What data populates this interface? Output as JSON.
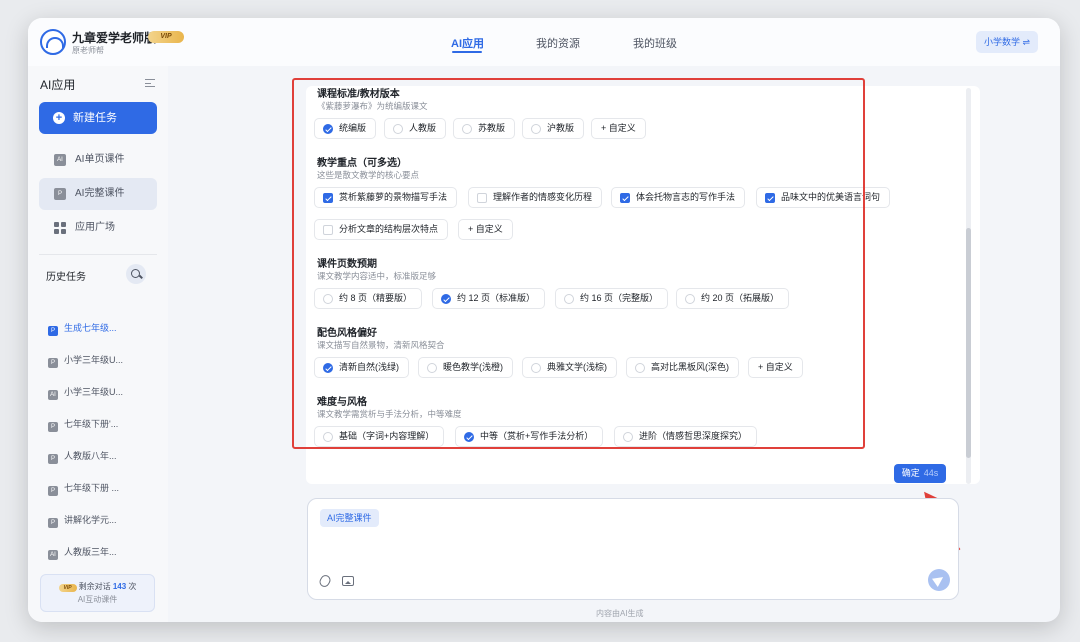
{
  "app": {
    "title": "九章爱学老师版",
    "subtitle": "原老师帮",
    "vip_badge": "VIP"
  },
  "nav": {
    "tabs": [
      {
        "label": "AI应用",
        "active": true
      },
      {
        "label": "我的资源",
        "active": false
      },
      {
        "label": "我的班级",
        "active": false
      }
    ],
    "subject": "小学数学 ⇌"
  },
  "sidebar": {
    "title": "AI应用",
    "new_task": "新建任务",
    "items": [
      {
        "label": "AI单页课件",
        "icon": "ai-page-icon"
      },
      {
        "label": "AI完整课件",
        "icon": "ai-full-icon",
        "active": true
      },
      {
        "label": "应用广场",
        "icon": "grid-icon"
      }
    ],
    "history_title": "历史任务",
    "history": [
      {
        "label": "生成七年级...",
        "icon": "P",
        "active": true
      },
      {
        "label": "小学三年级U...",
        "icon": "P"
      },
      {
        "label": "小学三年级U...",
        "icon": "AI"
      },
      {
        "label": "七年级下册'...",
        "icon": "P"
      },
      {
        "label": "人教版八年...",
        "icon": "P"
      },
      {
        "label": "七年级下册 ...",
        "icon": "P"
      },
      {
        "label": "讲解化学元...",
        "icon": "P"
      },
      {
        "label": "人教版三年...",
        "icon": "AI"
      }
    ],
    "quota": {
      "prefix": "剩余对话",
      "count": "143",
      "suffix": "次",
      "caption": "AI互动课件"
    }
  },
  "form": {
    "sections": [
      {
        "title": "课程标准/教材版本",
        "desc": "《紫藤萝瀑布》为统编版课文",
        "type": "radio",
        "options": [
          {
            "label": "统编版",
            "selected": true
          },
          {
            "label": "人教版",
            "selected": false
          },
          {
            "label": "苏教版",
            "selected": false
          },
          {
            "label": "沪教版",
            "selected": false
          }
        ],
        "custom": "+ 自定义"
      },
      {
        "title": "教学重点（可多选）",
        "desc": "这些是散文教学的核心要点",
        "type": "check",
        "options": [
          {
            "label": "赏析紫藤萝的景物描写手法",
            "selected": true
          },
          {
            "label": "理解作者的情感变化历程",
            "selected": false
          },
          {
            "label": "体会托物言志的写作手法",
            "selected": true
          },
          {
            "label": "品味文中的优美语言词句",
            "selected": true
          },
          {
            "label": "分析文章的结构层次特点",
            "selected": false
          }
        ],
        "custom": "+ 自定义"
      },
      {
        "title": "课件页数预期",
        "desc": "课文教学内容适中，标准版足够",
        "type": "radio",
        "options": [
          {
            "label": "约 8 页（精要版）",
            "selected": false
          },
          {
            "label": "约 12 页（标准版）",
            "selected": true
          },
          {
            "label": "约 16 页（完整版）",
            "selected": false
          },
          {
            "label": "约 20 页（拓展版）",
            "selected": false
          }
        ]
      },
      {
        "title": "配色风格偏好",
        "desc": "课文描写自然景物，清新风格契合",
        "type": "radio",
        "options": [
          {
            "label": "清新自然(浅绿)",
            "selected": true
          },
          {
            "label": "暖色教学(浅橙)",
            "selected": false
          },
          {
            "label": "典雅文学(浅棕)",
            "selected": false
          },
          {
            "label": "高对比黑板风(深色)",
            "selected": false
          }
        ],
        "custom": "+ 自定义"
      },
      {
        "title": "难度与风格",
        "desc": "课文教学需赏析与手法分析，中等难度",
        "type": "radio",
        "options": [
          {
            "label": "基础（字词+内容理解）",
            "selected": false
          },
          {
            "label": "中等（赏析+写作手法分析）",
            "selected": true
          },
          {
            "label": "进阶（情感哲思深度探究）",
            "selected": false
          }
        ]
      }
    ],
    "confirm": {
      "label": "确定",
      "countdown": "44s"
    }
  },
  "composer": {
    "chip": "AI完整课件",
    "footer": "内容由AI生成"
  },
  "colors": {
    "accent": "#2f6ae5",
    "annotation": "#e0403a"
  }
}
